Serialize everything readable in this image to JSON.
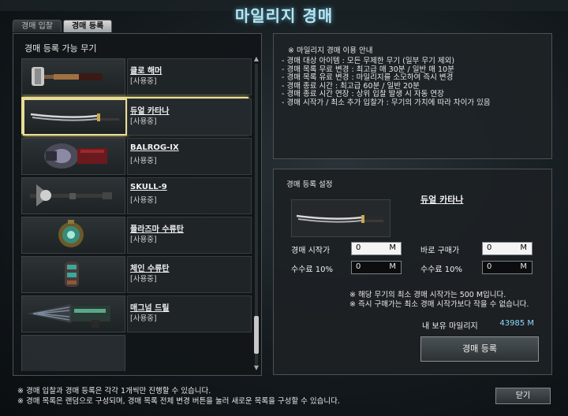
{
  "window": {
    "title": "마일리지 경매"
  },
  "tabs": [
    {
      "label": "경매 입찰",
      "active": false
    },
    {
      "label": "경매 등록",
      "active": true
    }
  ],
  "weapon_list": {
    "title": "경매 등록 가능 무기",
    "items": [
      {
        "name": "클로 해머",
        "status": "[사용중]",
        "icon": "claw-hammer-icon"
      },
      {
        "name": "듀얼 카타나",
        "status": "[사용중]",
        "icon": "dual-katana-icon",
        "selected": true
      },
      {
        "name": "BALROG-IX",
        "status": "[사용중]",
        "icon": "balrog-ix-icon"
      },
      {
        "name": "SKULL-9",
        "status": "[사용중]",
        "icon": "skull-9-icon"
      },
      {
        "name": "플라즈마 수류탄",
        "status": "[사용중]",
        "icon": "plasma-grenade-icon"
      },
      {
        "name": "체인 수류탄",
        "status": "[사용중]",
        "icon": "chain-grenade-icon"
      },
      {
        "name": "매그넘 드릴",
        "status": "[사용중]",
        "icon": "magnum-drill-icon"
      }
    ]
  },
  "info": {
    "title": "※ 마일리지 경매 이용 안내",
    "lines": [
      "- 경매 대상 아이템 : 모든 무제한 무기 (일부 무기 제외)",
      "- 경매 목록 무료 변경 : 최고급 매 30분 / 일반 매 10분",
      "- 경매 목록 유료 변경 : 마일리지를 소모하여 즉시 변경",
      "- 경매 종료 시간 : 최고급 60분 / 일반 20분",
      "- 경매 종료 시간 연장 : 상위 입찰 발생 시 자동 연장",
      "- 경매 시작가 / 최소 추가 입찰가 : 무기의 가치에 따라 차이가 있음"
    ]
  },
  "register": {
    "title": "경매 등록 설정",
    "weapon_name": "듀얼 카타나",
    "start_price_label": "경매 시작가",
    "start_price_value": "0",
    "buy_now_label": "바로 구매가",
    "buy_now_value": "0",
    "fee_label_1": "수수료 10%",
    "fee_value_1": "0",
    "fee_label_2": "수수료 10%",
    "fee_value_2": "0",
    "unit": "M",
    "note_1": "※ 해당 무기의 최소 경매 시작가는 500 M입니다.",
    "note_2": "※ 즉시 구매가는 최소 경매 시작가보다 작을 수 없습니다.",
    "mileage_label": "내 보유 마일리지",
    "mileage_value": "43985 M",
    "submit_label": "경매 등록"
  },
  "footer": {
    "line_1": "※ 경매 입찰과 경매 등록은 각각 1개씩만 진행할 수 있습니다.",
    "line_2": "※ 경매 목록은 랜덤으로 구성되며, 경매 목록 전체 변경 버튼을 눌러 새로운 목록을 구성할 수 있습니다.",
    "close_label": "닫기"
  },
  "colors": {
    "accent": "#e9dd95",
    "title": "#bfe3ee",
    "mileage": "#8fd7ff"
  }
}
